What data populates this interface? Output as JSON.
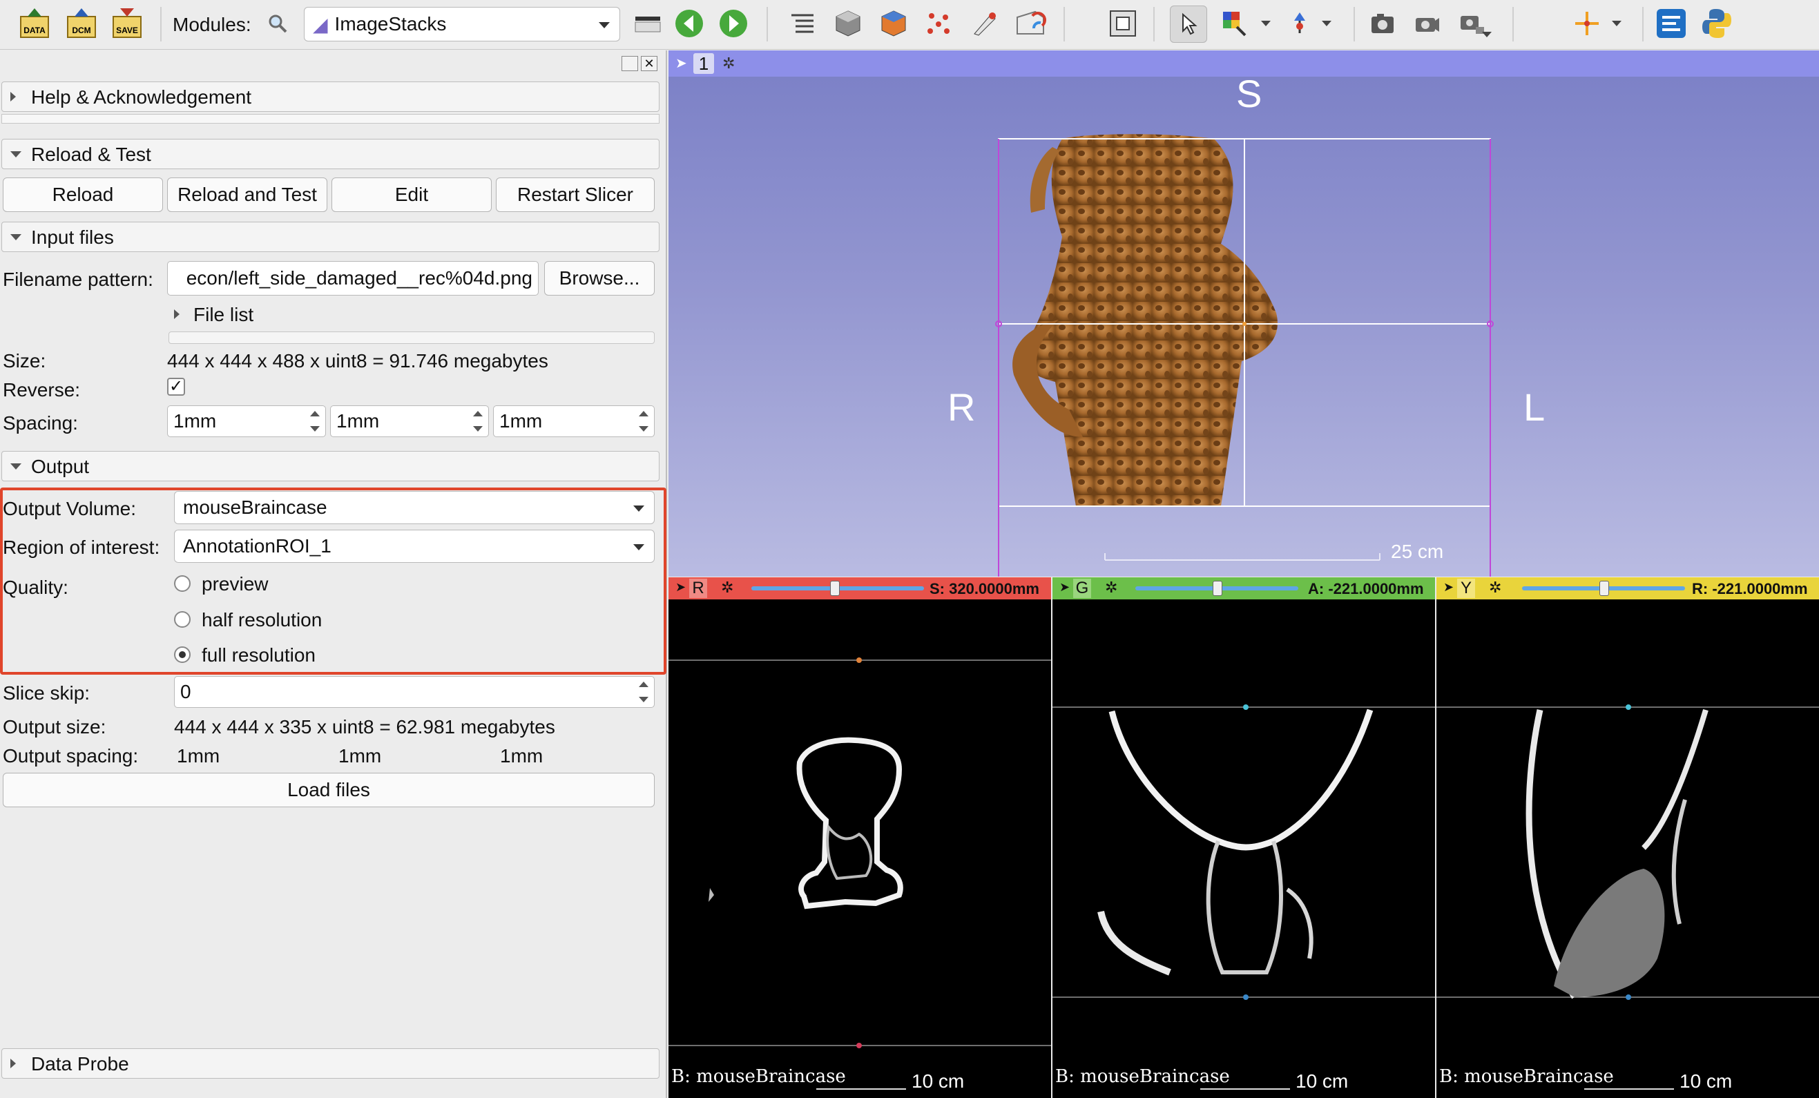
{
  "toolbar": {
    "modules_label": "Modules:",
    "module_selected": "ImageStacks",
    "icons": [
      "data-icon",
      "dcm-icon",
      "save-icon",
      "search-icon",
      "layout-icon",
      "back-icon",
      "forward-icon",
      "module-list-icon",
      "cube-icon",
      "volume-icon",
      "markups-icon",
      "segment-icon",
      "globe-icon",
      "toggle-view-icon",
      "pointer-icon",
      "colormap-icon",
      "fiducial-icon",
      "screenshot-icon",
      "camera-icon",
      "scene-icon",
      "crosshair-icon",
      "extension-icon",
      "python-icon"
    ],
    "data_label": "DATA",
    "dcm_label": "DCM",
    "save_label": "SAVE"
  },
  "panel": {
    "help": "Help & Acknowledgement",
    "reload_test": "Reload & Test",
    "buttons": {
      "reload": "Reload",
      "reload_and_test": "Reload and Test",
      "edit": "Edit",
      "restart": "Restart Slicer"
    },
    "input_files": "Input files",
    "filename_label": "Filename pattern:",
    "filename_value": "econ/left_side_damaged__rec%04d.png",
    "browse": "Browse...",
    "file_list": "File list",
    "size_label": "Size:",
    "size_value": "444 x 444 x 488 x uint8 = 91.746 megabytes",
    "reverse_label": "Reverse:",
    "reverse_checked": "✓",
    "spacing_label": "Spacing:",
    "spacing": [
      "1mm",
      "1mm",
      "1mm"
    ],
    "output": "Output",
    "output_volume_label": "Output Volume:",
    "output_volume_value": "mouseBraincase",
    "roi_label": "Region of interest:",
    "roi_value": "AnnotationROI_1",
    "quality_label": "Quality:",
    "quality_options": [
      "preview",
      "half resolution",
      "full resolution"
    ],
    "quality_selected": "full resolution",
    "slice_skip_label": "Slice skip:",
    "slice_skip_value": "0",
    "output_size_label": "Output size:",
    "output_size_value": "444 x 444 x 335 x uint8 = 62.981 megabytes",
    "output_spacing_label": "Output spacing:",
    "output_spacing": [
      "1mm",
      "1mm",
      "1mm"
    ],
    "load_files": "Load files",
    "data_probe": "Data Probe"
  },
  "view3d": {
    "number": "1",
    "orient_top": "S",
    "orient_left": "R",
    "orient_right": "L",
    "scale": "25 cm"
  },
  "slices": [
    {
      "id": "R",
      "color": "#e8524a",
      "offset": "S: 320.0000mm",
      "caption": "B: mouseBraincase",
      "scale": "10 cm",
      "slider_pos": 0.5
    },
    {
      "id": "G",
      "color": "#6cbf4a",
      "offset": "A: -221.0000mm",
      "caption": "B: mouseBraincase",
      "scale": "10 cm",
      "slider_pos": 0.5
    },
    {
      "id": "Y",
      "color": "#e9d43b",
      "offset": "R: -221.0000mm",
      "caption": "B: mouseBraincase",
      "scale": "10 cm",
      "slider_pos": 0.5
    }
  ],
  "colors": {
    "highlight_box": "#e0452b",
    "bone": "#b5793c"
  }
}
